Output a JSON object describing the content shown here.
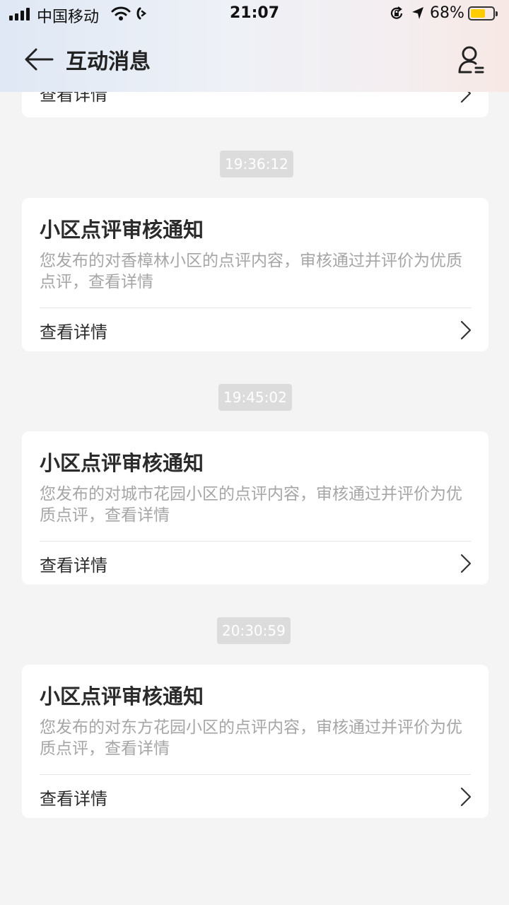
{
  "status_bar": {
    "carrier": "中国移动",
    "time": "21:07",
    "battery_percent": "68%",
    "battery_level": 0.68,
    "battery_color": "#ffcc00",
    "icons": [
      "signal-icon",
      "wifi-icon",
      "call-forward-icon",
      "rotation-lock-icon",
      "location-arrow-icon",
      "battery-icon"
    ]
  },
  "navbar": {
    "back_icon": "arrow-left-icon",
    "title": "互动消息",
    "profile_icon": "user-list-icon"
  },
  "messages": {
    "partial_card": {
      "detail_label": "查看详情"
    },
    "items": [
      {
        "timestamp": "19:36:12",
        "title": "小区点评审核通知",
        "body": "您发布的对香樟林小区的点评内容，审核通过并评价为优质点评，查看详情",
        "detail_label": "查看详情"
      },
      {
        "timestamp": "19:45:02",
        "title": "小区点评审核通知",
        "body": "您发布的对城市花园小区的点评内容，审核通过并评价为优质点评，查看详情",
        "detail_label": "查看详情"
      },
      {
        "timestamp": "20:30:59",
        "title": "小区点评审核通知",
        "body": "您发布的对东方花园小区的点评内容，审核通过并评价为优质点评，查看详情",
        "detail_label": "查看详情"
      }
    ]
  }
}
